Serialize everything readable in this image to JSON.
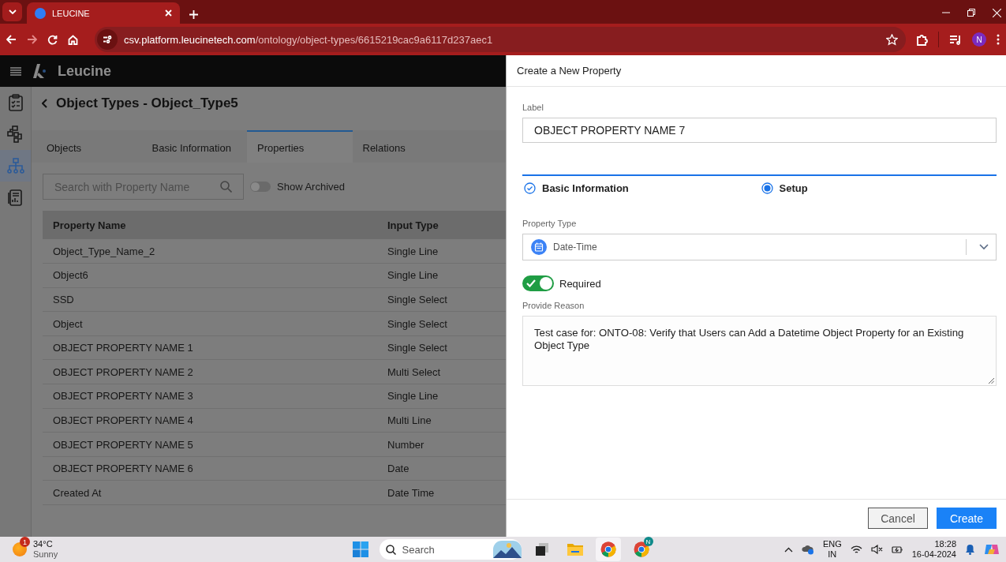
{
  "browser": {
    "tab_title": "LEUCINE",
    "url_host": "csv.platform.leucinetech.com",
    "url_path": "/ontology/object-types/6615219cac9a6117d237aec1",
    "profile_initial": "N"
  },
  "app": {
    "brand": "Leucine",
    "sidebar": [
      {
        "kind": "checklist",
        "selected": false
      },
      {
        "kind": "flow",
        "selected": false
      },
      {
        "kind": "hierarchy",
        "selected": true
      },
      {
        "kind": "report",
        "selected": false
      }
    ],
    "page_title": "Object Types - Object_Type5",
    "tabs": [
      {
        "label": "Objects",
        "selected": false
      },
      {
        "label": "Basic Information",
        "selected": false
      },
      {
        "label": "Properties",
        "selected": true
      },
      {
        "label": "Relations",
        "selected": false
      }
    ],
    "search": {
      "placeholder": "Search with Property Name"
    },
    "show_archived": {
      "label": "Show Archived",
      "on": false
    },
    "table": {
      "columns": [
        "Property Name",
        "Input Type"
      ],
      "rows": [
        [
          "Object_Type_Name_2",
          "Single Line"
        ],
        [
          "Object6",
          "Single Line"
        ],
        [
          "SSD",
          "Single Select"
        ],
        [
          "Object",
          "Single Select"
        ],
        [
          "OBJECT PROPERTY NAME 1",
          "Single Select"
        ],
        [
          "OBJECT PROPERTY NAME 2",
          "Multi Select"
        ],
        [
          "OBJECT PROPERTY NAME 3",
          "Single Line"
        ],
        [
          "OBJECT PROPERTY NAME 4",
          "Multi Line"
        ],
        [
          "OBJECT PROPERTY NAME 5",
          "Number"
        ],
        [
          "OBJECT PROPERTY NAME 6",
          "Date"
        ],
        [
          "Created At",
          "Date Time"
        ]
      ]
    }
  },
  "drawer": {
    "title": "Create a New Property",
    "label_field": {
      "label": "Label",
      "value": "OBJECT PROPERTY NAME 7"
    },
    "steps": [
      {
        "label": "Basic Information",
        "completed": true
      },
      {
        "label": "Setup",
        "completed": false
      }
    ],
    "property_type": {
      "label": "Property Type",
      "value": "Date-Time"
    },
    "required": {
      "label": "Required",
      "on": true
    },
    "reason": {
      "label": "Provide Reason",
      "value": "Test case for: ONTO-08: Verify that Users can Add a Datetime Object Property for an Existing Object Type"
    },
    "buttons": [
      {
        "label": "Cancel",
        "kind": "secondary"
      },
      {
        "label": "Create",
        "kind": "primary"
      }
    ]
  },
  "taskbar": {
    "weather": {
      "badge": "1",
      "temperature": "34°C",
      "condition": "Sunny"
    },
    "search": {
      "placeholder": "Search"
    },
    "chrome_badge": "N",
    "language": "ENG",
    "region": "IN",
    "time": "18:28",
    "date": "16-04-2024"
  }
}
